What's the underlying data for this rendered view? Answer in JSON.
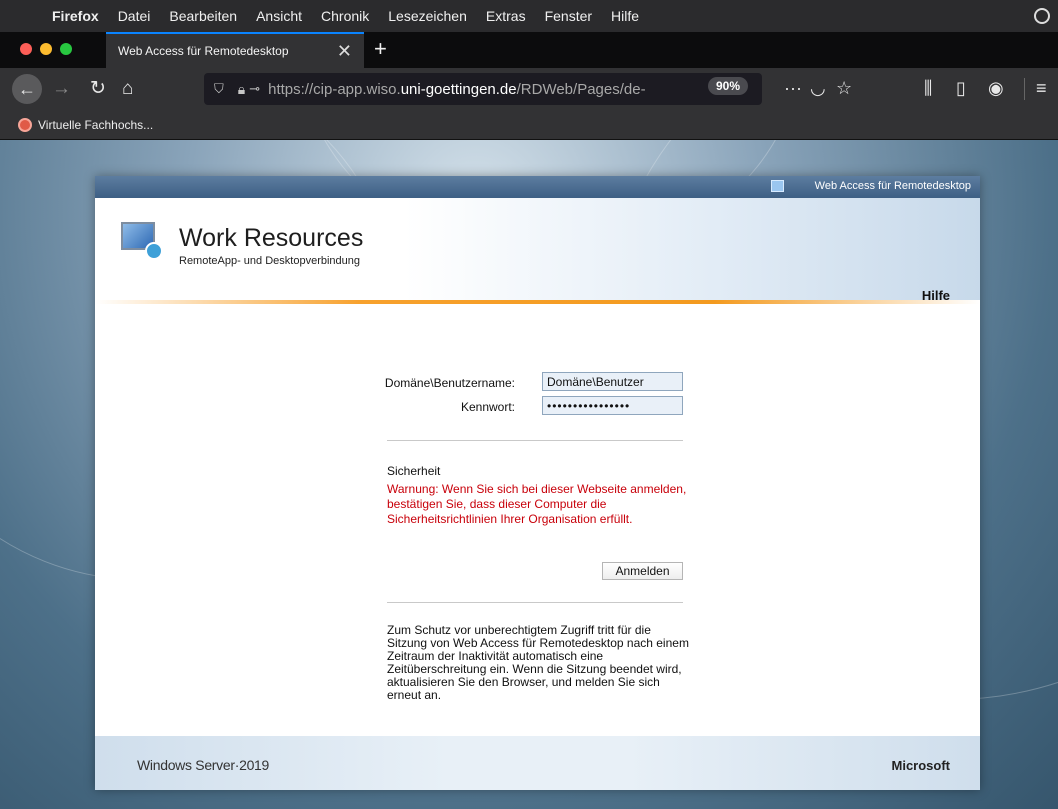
{
  "menubar": {
    "apple_icon": "apple-icon",
    "app_name": "Firefox",
    "items": [
      "Datei",
      "Bearbeiten",
      "Ansicht",
      "Chronik",
      "Lesezeichen",
      "Extras",
      "Fenster",
      "Hilfe"
    ]
  },
  "tab": {
    "title": "Web Access für Remotedesktop",
    "close_glyph": "✕",
    "new_tab_glyph": "+"
  },
  "navbar": {
    "url_prefix": "https://cip-app.wiso.",
    "url_host": "uni-goettingen.de",
    "url_path": "/RDWeb/Pages/de-",
    "zoom": "90%"
  },
  "bookmarks": {
    "items": [
      "Virtuelle Fachhochs..."
    ]
  },
  "card": {
    "topbar_label": "Web Access für Remotedesktop",
    "title": "Work Resources",
    "subtitle": "RemoteApp- und Desktopverbindung",
    "help": "Hilfe",
    "form": {
      "user_label": "Domäne\\Benutzername:",
      "user_value": "Domäne\\Benutzer",
      "password_label": "Kennwort:",
      "password_value": "••••••••••••••••",
      "security_heading": "Sicherheit",
      "security_warning": "Warnung: Wenn Sie sich bei dieser Webseite anmelden, bestätigen Sie, dass dieser Computer die Sicherheitsrichtlinien Ihrer Organisation erfüllt.",
      "login_button": "Anmelden",
      "info_text": "Zum Schutz vor unberechtigtem Zugriff tritt für die Sitzung von Web Access für Remotedesktop nach einem Zeitraum der Inaktivität automatisch eine Zeitüberschreitung ein. Wenn die Sitzung beendet wird, aktualisieren Sie den Browser, und melden Sie sich erneut an."
    },
    "footer_left": "Windows Server·2019",
    "footer_right": "Microsoft"
  },
  "colors": {
    "accent": "#0a84ff",
    "warning": "#c8000a",
    "orange": "#f39a1f"
  }
}
